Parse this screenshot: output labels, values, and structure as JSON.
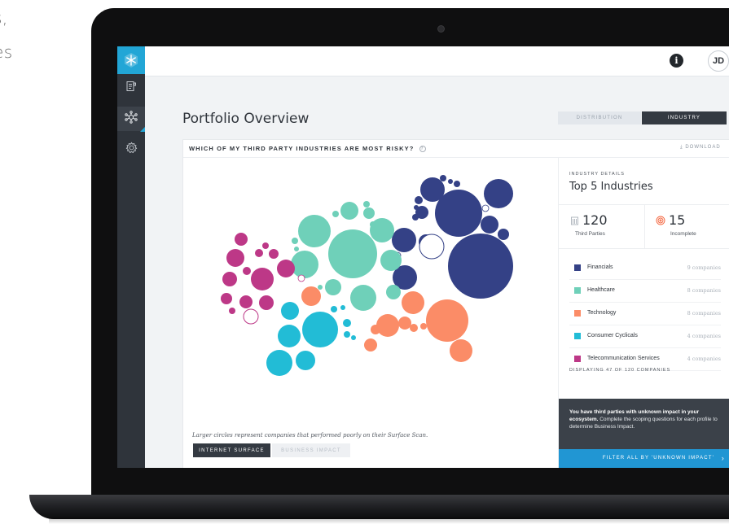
{
  "marketing": {
    "lines": [
      "s,",
      "es"
    ]
  },
  "topbar": {
    "info_label": "i",
    "avatar_initials": "JD"
  },
  "page": {
    "title": "Portfolio Overview",
    "toggle": {
      "distribution": "DISTRIBUTION",
      "industry": "INDUSTRY",
      "selected": "INDUSTRY"
    }
  },
  "card": {
    "question": "WHICH OF MY THIRD PARTY INDUSTRIES ARE MOST RISKY?",
    "help_label": "?",
    "download_label": "⤓ DOWNLOAD",
    "caption": "Larger circles represent companies that performed poorly on their Surface Scan.",
    "metric_buttons": {
      "internet": "INTERNET SURFACE",
      "impact": "BUSINESS IMPACT",
      "selected": "INTERNET SURFACE"
    }
  },
  "details": {
    "label": "INDUSTRY DETAILS",
    "title": "Top 5 Industries",
    "stats": {
      "third_parties": {
        "value": "120",
        "caption": "Third Parties"
      },
      "incomplete": {
        "value": "15",
        "caption": "Incomplete"
      }
    },
    "industries": [
      {
        "name": "Financials",
        "count": "9 companies",
        "color": "#344186"
      },
      {
        "name": "Healthcare",
        "count": "8 companies",
        "color": "#6fd0b9"
      },
      {
        "name": "Technology",
        "count": "8 companies",
        "color": "#fb8c67"
      },
      {
        "name": "Consumer Cyclicals",
        "count": "4 companies",
        "color": "#22bcd6"
      },
      {
        "name": "Telecommunication Services",
        "count": "4 companies",
        "color": "#bd3887"
      }
    ],
    "displaying": "DISPLAYING 47 OF 120 COMPANIES",
    "unknown_bold": "You have third parties with unknown impact in your ecosystem.",
    "unknown_rest": " Complete the scoping questions for each profile to determine Business Impact.",
    "filter_label": "FILTER ALL BY 'UNKNOWN IMPACT'",
    "filter_chevron": "›"
  },
  "colors": {
    "financials": "#344186",
    "healthcare": "#6fd0b9",
    "technology": "#fb8c67",
    "consumer": "#22bcd6",
    "telecom": "#bd3887",
    "accent": "#2196d3",
    "sidebar": "#2f343b"
  },
  "icons": {
    "logo": "snowflake-logo-icon",
    "nav": [
      "report-icon",
      "network-icon",
      "settings-gear-icon"
    ],
    "stats": [
      "building-icon",
      "target-icon"
    ],
    "download": "download-icon"
  }
}
